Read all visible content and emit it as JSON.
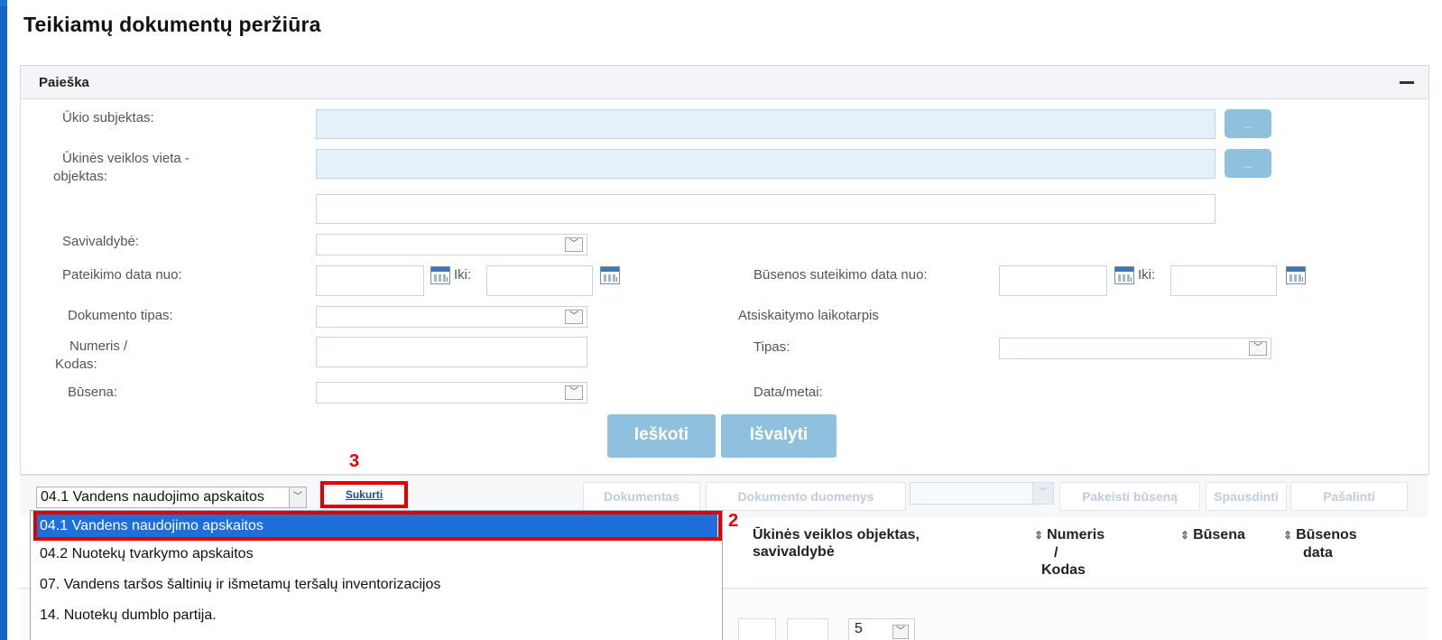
{
  "page_title": "Teikiamų dokumentų peržiūra",
  "search": {
    "title": "Paieška",
    "labels": {
      "subject": "Ūkio subjektas:",
      "location_1": "Ūkinės veiklos vieta -",
      "location_2": "objektas:",
      "municipality": "Savivaldybė:",
      "submit_from": "Pateikimo data nuo:",
      "to": "Iki:",
      "status_from": "Būsenos suteikimo data nuo:",
      "doc_type": "Dokumento tipas:",
      "period": "Atsiskaitymo laikotarpis",
      "number_1": "Numeris /",
      "number_2": "Kodas:",
      "type": "Tipas:",
      "status": "Būsena:",
      "date_year": "Data/metai:"
    },
    "dots_label": "..",
    "search_label": "Ieškoti",
    "clear_label": "Išvalyti"
  },
  "toolbar": {
    "selected_doc": "04.1 Vandens naudojimo apskaitos",
    "create_label": "Sukurti",
    "document_label": "Dokumentas",
    "document_data_label": "Dokumento duomenys",
    "change_status_label": "Pakeisti būseną",
    "print_label": "Spausdinti",
    "delete_label": "Pašalinti"
  },
  "table": {
    "columns": {
      "object_1": "Ūkinės veiklos objektas,",
      "object_2": "savivaldybė",
      "number_1": "Numeris",
      "number_2": "/",
      "number_3": "Kodas",
      "status": "Būsena",
      "status_date_1": "Būsenos",
      "status_date_2": "data"
    },
    "page_size": "5"
  },
  "dropdown": {
    "items": [
      "04.1 Vandens naudojimo apskaitos",
      "04.2 Nuotekų tvarkymo apskaitos",
      "07. Vandens taršos šaltinių ir išmetamų teršalų inventorizacijos",
      "14. Nuotekų dumblo partija."
    ]
  },
  "steps": {
    "two": "2",
    "three": "3"
  },
  "icons": {
    "collapse": "minus-icon",
    "calendar": "calendar-icon",
    "arrow": "chevron-down-icon",
    "sort": "sort-icon"
  },
  "colors": {
    "accent": "#8fc1df",
    "highlight": "#e00000",
    "selection": "#1e6fd9",
    "frame": "#1565c0"
  }
}
